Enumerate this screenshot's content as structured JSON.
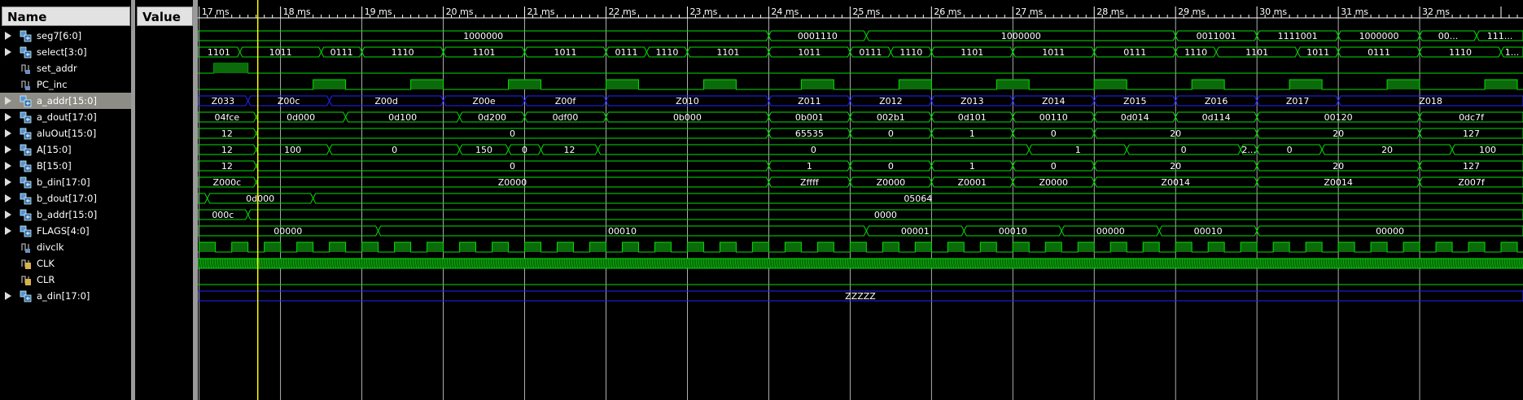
{
  "columns": {
    "name": "Name",
    "value": "Value"
  },
  "signals": [
    {
      "name": "seg7[6:0]",
      "value": "1000000",
      "kind": "bus"
    },
    {
      "name": "select[3:0]",
      "value": "1011",
      "kind": "bus"
    },
    {
      "name": "set_addr",
      "value": "0",
      "kind": "bit"
    },
    {
      "name": "PC_inc",
      "value": "0",
      "kind": "bit"
    },
    {
      "name": "a_addr[15:0]",
      "value": "Z00c",
      "kind": "bus",
      "selected": true
    },
    {
      "name": "a_dout[17:0]",
      "value": "04fce",
      "kind": "bus"
    },
    {
      "name": "aluOut[15:0]",
      "value": "12",
      "kind": "bus"
    },
    {
      "name": "A[15:0]",
      "value": "12",
      "kind": "bus"
    },
    {
      "name": "B[15:0]",
      "value": "12",
      "kind": "bus"
    },
    {
      "name": "b_din[17:0]",
      "value": "Z000c",
      "kind": "bus"
    },
    {
      "name": "b_dout[17:0]",
      "value": "0d000",
      "kind": "bus"
    },
    {
      "name": "b_addr[15:0]",
      "value": "000c",
      "kind": "bus"
    },
    {
      "name": "FLAGS[4:0]",
      "value": "00000",
      "kind": "bus"
    },
    {
      "name": "divclk",
      "value": "0",
      "kind": "bit"
    },
    {
      "name": "CLK",
      "value": "0",
      "kind": "bit",
      "locked": true
    },
    {
      "name": "CLR",
      "value": "0",
      "kind": "bit",
      "locked": true
    },
    {
      "name": "a_din[17:0]",
      "value": "ZZZZZ",
      "kind": "bus"
    }
  ],
  "timeline": {
    "ticks": [
      "17 ms",
      "18 ms",
      "19 ms",
      "20 ms",
      "21 ms",
      "22 ms",
      "23 ms",
      "24 ms",
      "25 ms",
      "26 ms",
      "27 ms",
      "28 ms",
      "29 ms",
      "30 ms",
      "31 ms",
      "32 ms"
    ],
    "start_ms": 16.983,
    "end_ms": 33.27,
    "cursor_ms": 17.72
  },
  "colors": {
    "wave": "#00e000",
    "highz": "#2222ff",
    "grid": "#ffffff",
    "cursor": "#ffff00",
    "clock_fill": "#0b6b0b",
    "text": "#ffffff"
  },
  "waves": [
    {
      "type": "bus",
      "segs": [
        [
          16.983,
          24.0,
          "1000000"
        ],
        [
          24.0,
          25.2,
          "0001110"
        ],
        [
          25.2,
          29.0,
          "1000000"
        ],
        [
          29.0,
          30.0,
          "0011001"
        ],
        [
          30.0,
          31.0,
          "1111001"
        ],
        [
          31.0,
          32.0,
          "1000000"
        ],
        [
          32.0,
          32.7,
          "00..."
        ],
        [
          32.7,
          33.27,
          "111..."
        ]
      ]
    },
    {
      "type": "bus",
      "segs": [
        [
          16.983,
          17.5,
          "1101"
        ],
        [
          17.5,
          18.5,
          "1011"
        ],
        [
          18.5,
          19.0,
          "0111"
        ],
        [
          19.0,
          20.0,
          "1110"
        ],
        [
          20.0,
          21.0,
          "1101"
        ],
        [
          21.0,
          22.0,
          "1011"
        ],
        [
          22.0,
          22.5,
          "0111"
        ],
        [
          22.5,
          23.0,
          "1110"
        ],
        [
          23.0,
          24.0,
          "1101"
        ],
        [
          24.0,
          25.0,
          "1011"
        ],
        [
          25.0,
          25.5,
          "0111"
        ],
        [
          25.5,
          26.0,
          "1110"
        ],
        [
          26.0,
          27.0,
          "1101"
        ],
        [
          27.0,
          28.0,
          "1011"
        ],
        [
          28.0,
          29.0,
          "0111"
        ],
        [
          29.0,
          29.5,
          "1110"
        ],
        [
          29.5,
          30.5,
          "1101"
        ],
        [
          30.5,
          31.0,
          "1011"
        ],
        [
          31.0,
          32.0,
          "0111"
        ],
        [
          32.0,
          33.0,
          "1110"
        ],
        [
          33.0,
          33.27,
          "1101"
        ]
      ]
    },
    {
      "type": "bit",
      "edges": [
        [
          17.18,
          1
        ],
        [
          17.6,
          0
        ]
      ]
    },
    {
      "type": "clock",
      "highs": [
        [
          18.4,
          18.8
        ],
        [
          19.6,
          20.0
        ],
        [
          20.8,
          21.2
        ],
        [
          22.0,
          22.4
        ],
        [
          23.2,
          23.6
        ],
        [
          24.4,
          24.8
        ],
        [
          25.6,
          26.0
        ],
        [
          26.8,
          27.2
        ],
        [
          28.0,
          28.4
        ],
        [
          29.2,
          29.6
        ],
        [
          30.4,
          30.8
        ],
        [
          31.6,
          32.0
        ],
        [
          32.8,
          33.2
        ]
      ]
    },
    {
      "type": "bus",
      "highz": true,
      "segs": [
        [
          16.983,
          17.6,
          "Z033"
        ],
        [
          17.6,
          18.6,
          "Z00c"
        ],
        [
          18.6,
          20.0,
          "Z00d"
        ],
        [
          20.0,
          21.0,
          "Z00e"
        ],
        [
          21.0,
          22.0,
          "Z00f"
        ],
        [
          22.0,
          24.0,
          "Z010"
        ],
        [
          24.0,
          25.0,
          "Z011"
        ],
        [
          25.0,
          26.0,
          "Z012"
        ],
        [
          26.0,
          27.0,
          "Z013"
        ],
        [
          27.0,
          28.0,
          "Z014"
        ],
        [
          28.0,
          29.0,
          "Z015"
        ],
        [
          29.0,
          30.0,
          "Z016"
        ],
        [
          30.0,
          31.0,
          "Z017"
        ],
        [
          31.0,
          33.27,
          "Z018"
        ]
      ]
    },
    {
      "type": "bus",
      "segs": [
        [
          16.983,
          17.7,
          "04fce"
        ],
        [
          17.7,
          18.8,
          "0d000"
        ],
        [
          18.8,
          20.2,
          "0d100"
        ],
        [
          20.2,
          21.0,
          "0d200"
        ],
        [
          21.0,
          22.0,
          "0df00"
        ],
        [
          22.0,
          24.0,
          "0b000"
        ],
        [
          24.0,
          25.0,
          "0b001"
        ],
        [
          25.0,
          26.0,
          "002b1"
        ],
        [
          26.0,
          27.0,
          "0d101"
        ],
        [
          27.0,
          28.0,
          "00110"
        ],
        [
          28.0,
          29.0,
          "0d014"
        ],
        [
          29.0,
          30.0,
          "0d114"
        ],
        [
          30.0,
          32.0,
          "00120"
        ],
        [
          32.0,
          33.27,
          "0dc7f"
        ]
      ]
    },
    {
      "type": "bus",
      "segs": [
        [
          16.983,
          17.7,
          "12"
        ],
        [
          17.7,
          24.0,
          "0"
        ],
        [
          24.0,
          25.0,
          "65535"
        ],
        [
          25.0,
          26.0,
          "0"
        ],
        [
          26.0,
          27.0,
          "1"
        ],
        [
          27.0,
          28.0,
          "0"
        ],
        [
          28.0,
          30.0,
          "20"
        ],
        [
          30.0,
          32.0,
          "20"
        ],
        [
          32.0,
          33.27,
          "127"
        ]
      ]
    },
    {
      "type": "bus",
      "segs": [
        [
          16.983,
          17.7,
          "12"
        ],
        [
          17.7,
          18.6,
          "100"
        ],
        [
          18.6,
          20.2,
          "0"
        ],
        [
          20.2,
          20.8,
          "150"
        ],
        [
          20.8,
          21.2,
          "0"
        ],
        [
          21.2,
          21.9,
          "12"
        ],
        [
          21.9,
          27.2,
          "0"
        ],
        [
          27.2,
          28.4,
          "1"
        ],
        [
          28.4,
          29.8,
          "0"
        ],
        [
          29.8,
          30.0,
          "20"
        ],
        [
          30.0,
          30.8,
          "0"
        ],
        [
          30.8,
          32.4,
          "20"
        ],
        [
          32.4,
          33.27,
          "100"
        ]
      ]
    },
    {
      "type": "bus",
      "segs": [
        [
          16.983,
          17.7,
          "12"
        ],
        [
          17.7,
          24.0,
          "0"
        ],
        [
          24.0,
          25.0,
          "1"
        ],
        [
          25.0,
          26.0,
          "0"
        ],
        [
          26.0,
          27.0,
          "1"
        ],
        [
          27.0,
          28.0,
          "0"
        ],
        [
          28.0,
          30.0,
          "20"
        ],
        [
          30.0,
          32.0,
          "20"
        ],
        [
          32.0,
          33.27,
          "127"
        ]
      ]
    },
    {
      "type": "bus",
      "segs": [
        [
          16.983,
          17.7,
          "Z000c"
        ],
        [
          17.7,
          24.0,
          "Z0000"
        ],
        [
          24.0,
          25.0,
          "Zffff"
        ],
        [
          25.0,
          26.0,
          "Z0000"
        ],
        [
          26.0,
          27.0,
          "Z0001"
        ],
        [
          27.0,
          28.0,
          "Z0000"
        ],
        [
          28.0,
          30.0,
          "Z0014"
        ],
        [
          30.0,
          32.0,
          "Z0014"
        ],
        [
          32.0,
          33.27,
          "Z007f"
        ]
      ]
    },
    {
      "type": "bus",
      "segs": [
        [
          16.983,
          17.1,
          "..."
        ],
        [
          17.1,
          18.4,
          "0d000"
        ],
        [
          18.4,
          33.27,
          "05064"
        ]
      ]
    },
    {
      "type": "bus",
      "segs": [
        [
          16.983,
          17.6,
          "000c"
        ],
        [
          17.6,
          33.27,
          "0000"
        ]
      ]
    },
    {
      "type": "bus",
      "segs": [
        [
          16.983,
          19.2,
          "00000"
        ],
        [
          19.2,
          25.2,
          "00010"
        ],
        [
          25.2,
          26.4,
          "00001"
        ],
        [
          26.4,
          27.6,
          "00010"
        ],
        [
          27.6,
          28.8,
          "00000"
        ],
        [
          28.8,
          30.0,
          "00010"
        ],
        [
          30.0,
          33.27,
          "00000"
        ]
      ]
    },
    {
      "type": "clock",
      "highs": [
        [
          17.0,
          17.2
        ],
        [
          17.4,
          17.6
        ],
        [
          17.8,
          18.0
        ],
        [
          18.2,
          18.4
        ],
        [
          18.6,
          18.8
        ],
        [
          19.0,
          19.2
        ],
        [
          19.4,
          19.6
        ],
        [
          19.8,
          20.0
        ],
        [
          20.2,
          20.4
        ],
        [
          20.6,
          20.8
        ],
        [
          21.0,
          21.2
        ],
        [
          21.4,
          21.6
        ],
        [
          21.8,
          22.0
        ],
        [
          22.2,
          22.4
        ],
        [
          22.6,
          22.8
        ],
        [
          23.0,
          23.2
        ],
        [
          23.4,
          23.6
        ],
        [
          23.8,
          24.0
        ],
        [
          24.2,
          24.4
        ],
        [
          24.6,
          24.8
        ],
        [
          25.0,
          25.2
        ],
        [
          25.4,
          25.6
        ],
        [
          25.8,
          26.0
        ],
        [
          26.2,
          26.4
        ],
        [
          26.6,
          26.8
        ],
        [
          27.0,
          27.2
        ],
        [
          27.4,
          27.6
        ],
        [
          27.8,
          28.0
        ],
        [
          28.2,
          28.4
        ],
        [
          28.6,
          28.8
        ],
        [
          29.0,
          29.2
        ],
        [
          29.4,
          29.6
        ],
        [
          29.8,
          30.0
        ],
        [
          30.2,
          30.4
        ],
        [
          30.6,
          30.8
        ],
        [
          31.0,
          31.2
        ],
        [
          31.4,
          31.6
        ],
        [
          31.8,
          32.0
        ],
        [
          32.2,
          32.4
        ],
        [
          32.6,
          32.8
        ],
        [
          33.0,
          33.2
        ]
      ]
    },
    {
      "type": "denseclock"
    },
    {
      "type": "bit",
      "edges": []
    },
    {
      "type": "bus",
      "highz": true,
      "segs": [
        [
          16.983,
          33.27,
          "ZZZZZ"
        ]
      ]
    }
  ]
}
